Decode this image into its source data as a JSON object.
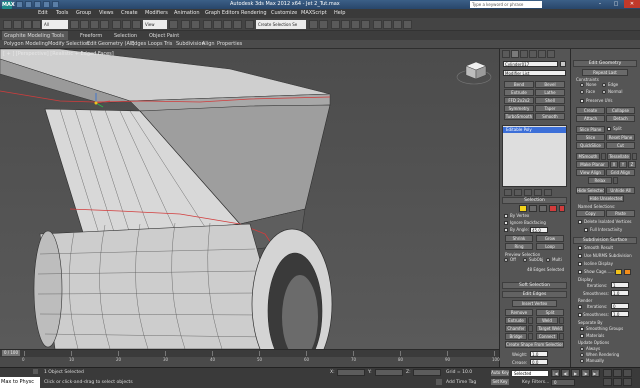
{
  "window": {
    "title": "Autodesk 3ds Max 2012 x64 - Jet 2_Tut.max",
    "logo": "MAX",
    "workspace": "Workspace: Default",
    "search_placeholder": "Type a keyword or phrase",
    "controls": [
      "–",
      "□",
      "✕"
    ]
  },
  "menu": [
    "Edit",
    "Tools",
    "Group",
    "Views",
    "Create",
    "Modifiers",
    "Animation",
    "Graph Editors",
    "Rendering",
    "Customize",
    "MAXScript",
    "Help"
  ],
  "toolbar": {
    "selection_filter": "All",
    "view_dropdown": "View",
    "named_set_placeholder": "Create Selection Se"
  },
  "ribbon": {
    "tabs": [
      "Graphite Modeling Tools",
      "Freeform",
      "Selection",
      "Object Paint"
    ],
    "subtabs": [
      "Polygon Modeling",
      "Modify Selection",
      "Edit",
      "Geometry (All)",
      "Edges",
      "Loops",
      "Tris",
      "Subdivision",
      "Align",
      "Properties"
    ]
  },
  "viewport": {
    "label": "[ + ] [Perspective] [Realistic + Edged Faces]"
  },
  "command_panel": {
    "object_name": "Cylinder017",
    "modifier_list": "Modifier List",
    "modifier_buttons": [
      "Bend",
      "Bevel",
      "Extrude",
      "Lathe",
      "FFD 2x2x2",
      "Shell",
      "Symmetry",
      "Taper",
      "TurboSmooth",
      "Smooth"
    ],
    "stack_item": "Editable Poly",
    "selection": {
      "title": "Selection",
      "by_vertex": "By Vertex",
      "ignore_backfacing": "Ignore Backfacing",
      "by_angle": "By Angle:",
      "by_angle_value": "45.0",
      "shrink": "Shrink",
      "grow": "Grow",
      "ring": "Ring",
      "loop": "Loop",
      "preview_label": "Preview Selection",
      "preview_off": "Off",
      "preview_subobj": "SubObj",
      "preview_multi": "Multi",
      "status": "48 Edges Selected"
    },
    "soft_selection": "Soft Selection",
    "edit_edges": {
      "title": "Edit Edges",
      "insert_vertex": "Insert Vertex",
      "remove": "Remove",
      "split": "Split",
      "extrude": "Extrude",
      "weld": "Weld",
      "chamfer": "Chamfer",
      "target_weld": "Target Weld",
      "bridge": "Bridge",
      "connect": "Connect",
      "create_shape": "Create Shape From Selection",
      "weight_label": "Weight:",
      "weight_value": "1.0",
      "crease_label": "Crease:",
      "crease_value": "0.0"
    }
  },
  "edit_geometry": {
    "title": "Edit Geometry",
    "repeat_last": "Repeat Last",
    "constraints": "Constraints",
    "none": "None",
    "edge": "Edge",
    "face": "Face",
    "normal": "Normal",
    "preserve_uvs": "Preserve UVs",
    "create": "Create",
    "collapse": "Collapse",
    "attach": "Attach",
    "detach": "Detach",
    "slice_plane": "Slice Plane",
    "split": "Split",
    "slice": "Slice",
    "reset_plane": "Reset Plane",
    "quickslice": "QuickSlice",
    "cut": "Cut",
    "msmooth": "MSmooth",
    "tessellate": "Tessellate",
    "make_planar": "Make Planar",
    "x": "X",
    "y": "Y",
    "z": "Z",
    "view_align": "View Align",
    "grid_align": "Grid Align",
    "relax": "Relax",
    "hide_selected": "Hide Selected",
    "unhide_all": "Unhide All",
    "hide_unselected": "Hide Unselected",
    "named_selections": "Named Selections:",
    "copy": "Copy",
    "paste": "Paste",
    "delete_isolated": "Delete Isolated Vertices",
    "full_interactivity": "Full Interactivity"
  },
  "subdivision_surface": {
    "title": "Subdivision Surface",
    "smooth_result": "Smooth Result",
    "use_nurms": "Use NURMS Subdivision",
    "isoline_display": "Isoline Display",
    "show_cage": "Show Cage......",
    "display_label": "Display",
    "iterations_label": "Iterations:",
    "iterations_value": "1",
    "smoothness_label": "Smoothness:",
    "smoothness_value": "1.0",
    "render_label": "Render",
    "render_iterations_value": "0",
    "render_smoothness_value": "1.0",
    "separate_by": "Separate By",
    "smoothing_groups": "Smoothing Groups",
    "materials": "Materials",
    "update_options": "Update Options",
    "always": "Always",
    "when_rendering": "When Rendering",
    "manually": "Manually"
  },
  "timeline": {
    "slider": "0 / 100",
    "ticks": [
      "0",
      "10",
      "20",
      "30",
      "40",
      "50",
      "60",
      "70",
      "80",
      "90",
      "100"
    ]
  },
  "status": {
    "maxscript": "Max to Physc",
    "objects_selected": "1 Object Selected",
    "prompt": "Click or click-and-drag to select objects",
    "x_label": "X:",
    "y_label": "Y:",
    "z_label": "Z:",
    "grid": "Grid = 10.0",
    "auto_key": "Auto Key",
    "selected": "Selected",
    "set_key": "Set Key",
    "key_filters": "Key Filters...",
    "add_time_tag": "Add Time Tag",
    "frame": "0"
  },
  "colors": {
    "selected_edge": "#d23c3c",
    "stack_highlight": "#3c6fd8",
    "cage_yellow": "#f2c21a",
    "cage_orange": "#f28c1a"
  }
}
